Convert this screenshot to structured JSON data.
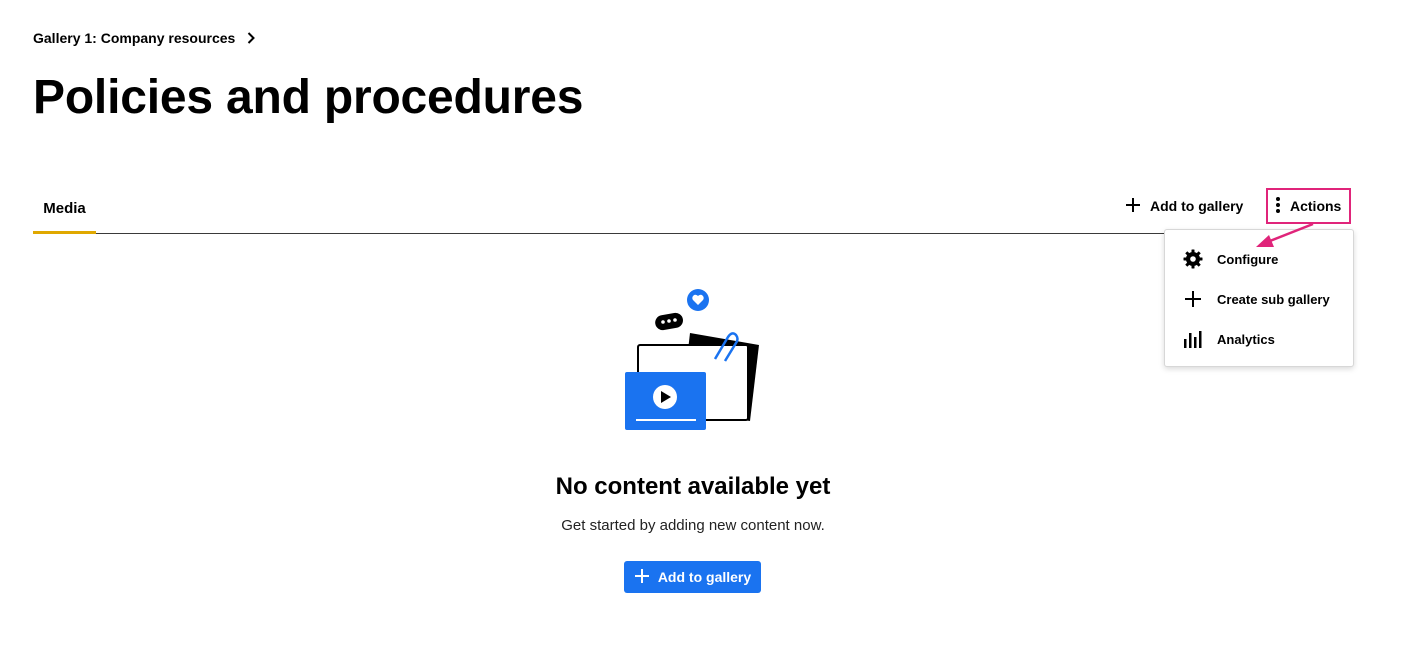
{
  "breadcrumb": {
    "label": "Gallery 1: Company resources",
    "chevron_icon": "chevron-right-icon"
  },
  "page": {
    "title": "Policies and procedures"
  },
  "tabs": [
    {
      "label": "Media",
      "active": true
    }
  ],
  "toolbar": {
    "add_to_gallery_label": "Add to gallery",
    "add_icon": "plus-icon",
    "actions_label": "Actions",
    "actions_icon": "more-vertical-icon"
  },
  "actions_menu": {
    "items": [
      {
        "label": "Configure",
        "icon": "gear-icon"
      },
      {
        "label": "Create sub gallery",
        "icon": "plus-icon"
      },
      {
        "label": "Analytics",
        "icon": "bar-chart-icon"
      }
    ]
  },
  "empty_state": {
    "title": "No content available yet",
    "subtitle": "Get started by adding new content now.",
    "button_label": "Add to gallery"
  },
  "colors": {
    "accent_blue": "#1a73f0",
    "tab_underline": "#e0a800",
    "highlight_pink": "#e0247a"
  }
}
